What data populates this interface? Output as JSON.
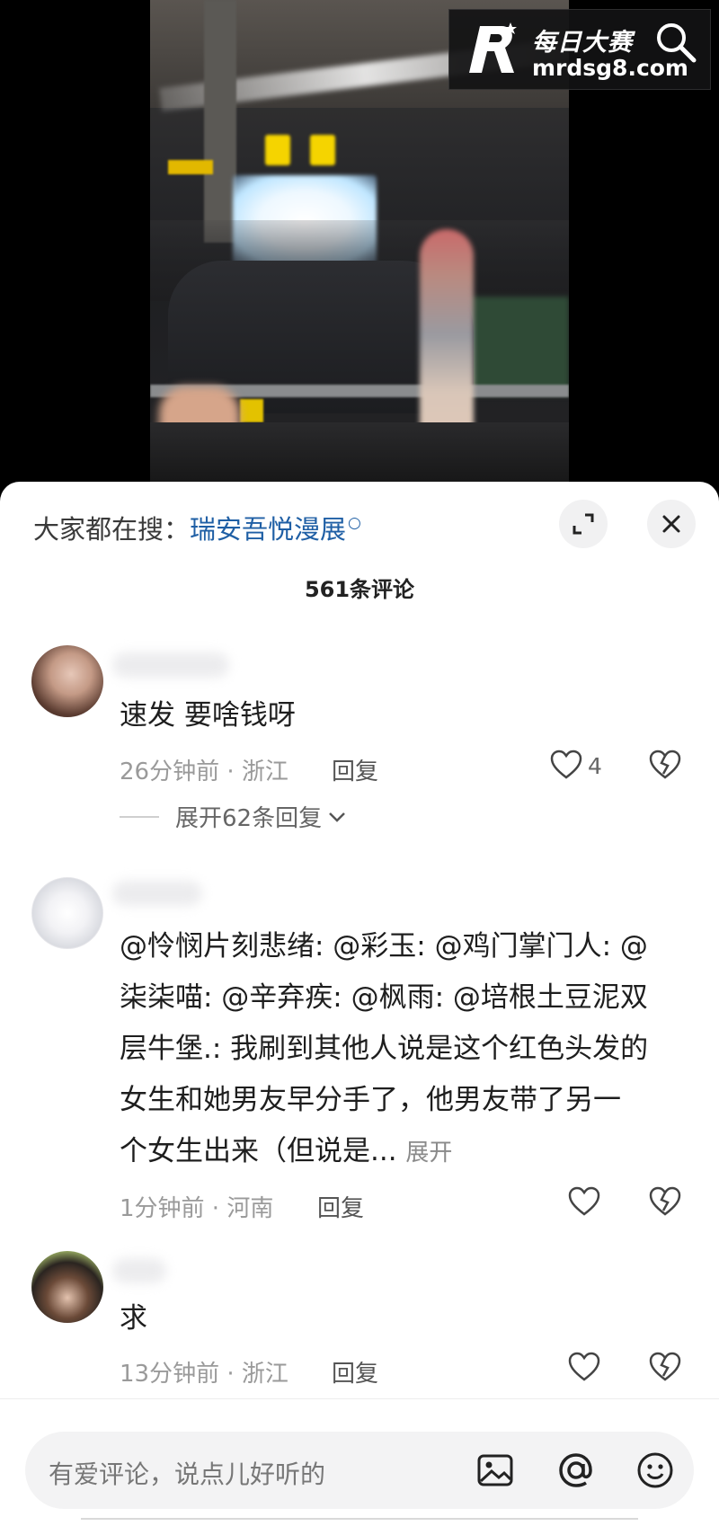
{
  "video": {
    "watermark": {
      "brand_cn": "每日大赛",
      "domain": "mrdsg8.com"
    }
  },
  "sheet": {
    "trending_label": "大家都在搜：",
    "trending_keyword": "瑞安吾悦漫展",
    "comment_count": "561条评论"
  },
  "comments": [
    {
      "text": "速发 要啥钱呀",
      "time_location": "26分钟前 · 浙江",
      "reply_label": "回复",
      "likes": "4",
      "expand_replies": "展开62条回复"
    },
    {
      "line1": "@怜悯片刻悲绪: @彩玉: @鸡门掌门人: @",
      "line2": "柒柒喵: @辛弃疾: @枫雨: @培根土豆泥双",
      "line3": "层牛堡.: 我刷到其他人说是这个红色头发的",
      "line4": "女生和她男友早分手了，他男友带了另一",
      "line5": "个女生出来（但说是...",
      "more_label": "展开",
      "time_location": "1分钟前 · 河南",
      "reply_label": "回复"
    },
    {
      "text": "求",
      "time_location": "13分钟前 · 浙江",
      "reply_label": "回复"
    }
  ],
  "input": {
    "placeholder": "有爱评论，说点儿好听的"
  },
  "icons": [
    "search-icon",
    "expand-icon",
    "close-icon",
    "heart-icon",
    "broken-heart-icon",
    "image-icon",
    "at-icon",
    "emoji-icon",
    "chevron-down-icon"
  ],
  "colors": {
    "keyword": "#1f5fa5",
    "sheet_bg": "#ffffff",
    "video_bg": "#000000"
  }
}
